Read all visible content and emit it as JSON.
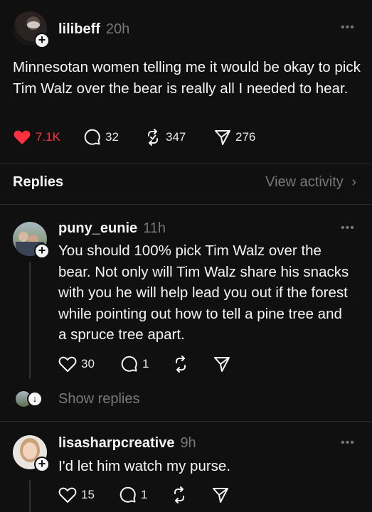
{
  "post": {
    "username": "lilibeff",
    "time": "20h",
    "text": "Minnesotan women telling me it would be okay to pick Tim Walz over the bear is really all I needed to hear.",
    "likes": "7.1K",
    "comments": "32",
    "reposts": "347",
    "shares": "276"
  },
  "replies_header": {
    "title": "Replies",
    "view_activity": "View activity"
  },
  "replies": [
    {
      "username": "puny_eunie",
      "time": "11h",
      "text": "You should 100% pick Tim Walz over the bear. Not only will Tim Walz share his snacks with you he will help lead you out if the forest while pointing out how to tell a pine tree and a spruce tree apart.",
      "likes": "30",
      "comments": "1"
    },
    {
      "username": "lisasharpcreative",
      "time": "9h",
      "text": "I'd let him watch my purse.",
      "likes": "15",
      "comments": "1"
    }
  ],
  "show_replies": "Show replies",
  "colors": {
    "like_red": "#ff3040",
    "bg": "#101010",
    "muted": "#777777"
  },
  "icons": [
    "heart-icon",
    "comment-icon",
    "repost-icon",
    "share-icon",
    "more-icon",
    "plus-icon",
    "chevron-right-icon",
    "down-arrow-icon"
  ]
}
